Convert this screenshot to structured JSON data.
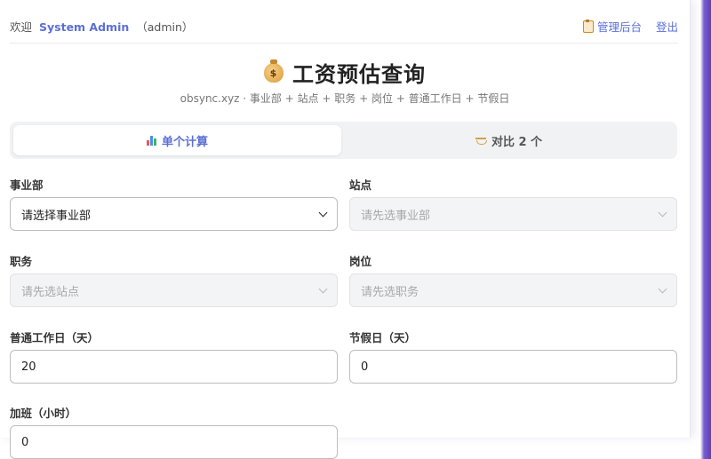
{
  "header": {
    "welcome": "欢迎",
    "username": "System Admin",
    "role": "（admin）",
    "admin_link": "管理后台",
    "logout": "登出"
  },
  "page": {
    "title": "工资预估查询",
    "subtitle": "obsync.xyz · 事业部 + 站点 + 职务 + 岗位 + 普通工作日 + 节假日"
  },
  "tabs": [
    {
      "label": "单个计算",
      "active": true
    },
    {
      "label": "对比 2 个",
      "active": false
    }
  ],
  "form": {
    "division": {
      "label": "事业部",
      "value": "请选择事业部"
    },
    "site": {
      "label": "站点",
      "value": "请先选事业部"
    },
    "job": {
      "label": "职务",
      "value": "请先选站点"
    },
    "position": {
      "label": "岗位",
      "value": "请先选职务"
    },
    "workdays": {
      "label": "普通工作日（天）",
      "value": "20"
    },
    "holidays": {
      "label": "节假日（天）",
      "value": "0"
    },
    "overtime": {
      "label": "加班（小时）",
      "value": "0"
    }
  },
  "colors": {
    "accent": "#5b6fd6",
    "border": "#d9d9d9",
    "disabled_bg": "#f3f4f6"
  }
}
